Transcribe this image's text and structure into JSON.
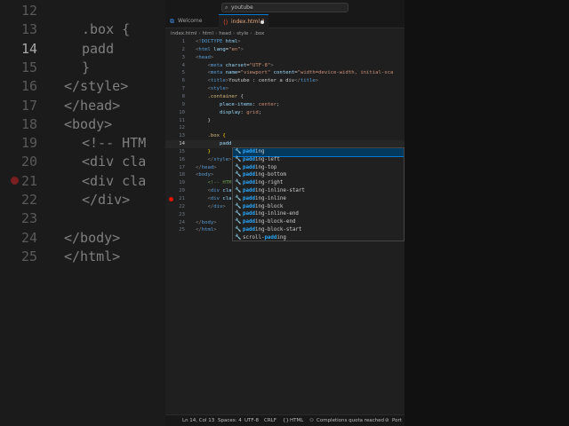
{
  "background": {
    "left_lines": [
      {
        "num": "12",
        "text": "",
        "current": false
      },
      {
        "num": "13",
        "text": ".box {",
        "current": false
      },
      {
        "num": "14",
        "text": "padd",
        "current": true
      },
      {
        "num": "15",
        "text": "}",
        "current": false
      },
      {
        "num": "16",
        "text": "</style>",
        "current": false
      },
      {
        "num": "17",
        "text": "</head>",
        "current": false
      },
      {
        "num": "18",
        "text": "<body>",
        "current": false
      },
      {
        "num": "19",
        "text": "<!-- HTM",
        "current": false
      },
      {
        "num": "20",
        "text": "<div cla",
        "current": false
      },
      {
        "num": "21",
        "text": "<div cla",
        "current": false
      },
      {
        "num": "22",
        "text": "</div>",
        "current": false
      },
      {
        "num": "23",
        "text": "",
        "current": false
      },
      {
        "num": "24",
        "text": "</body>",
        "current": false
      },
      {
        "num": "25",
        "text": "</html>",
        "current": false
      }
    ]
  },
  "titlebar": {
    "search_text": "youtube",
    "search_icon": "search-icon"
  },
  "tabs": [
    {
      "label": "Welcome",
      "icon": "vscode-icon",
      "active": false
    },
    {
      "label": "index.html 2",
      "icon": "html5-icon",
      "active": true
    }
  ],
  "breadcrumb": [
    "index.html",
    "html",
    "head",
    "style",
    ".box"
  ],
  "editor": {
    "lines": [
      {
        "num": "1",
        "html": "<span class='t-pun'>&lt;!</span><span class='t-tag'>DOCTYPE</span> <span class='t-attr'>html</span><span class='t-pun'>&gt;</span>"
      },
      {
        "num": "2",
        "html": "<span class='t-pun'>&lt;</span><span class='t-tag'>html</span> <span class='t-attr'>lang</span>=<span class='t-str'>\"en\"</span><span class='t-pun'>&gt;</span>"
      },
      {
        "num": "3",
        "html": "<span class='t-pun'>&lt;</span><span class='t-tag'>head</span><span class='t-pun'>&gt;</span>"
      },
      {
        "num": "4",
        "html": "    <span class='t-pun'>&lt;</span><span class='t-tag'>meta</span> <span class='t-attr'>charset</span>=<span class='t-str'>\"UTF-8\"</span><span class='t-pun'>&gt;</span>"
      },
      {
        "num": "5",
        "html": "    <span class='t-pun'>&lt;</span><span class='t-tag'>meta</span> <span class='t-attr'>name</span>=<span class='t-str'>\"viewport\"</span> <span class='t-attr'>content</span>=<span class='t-str'>\"width=device-width, initial-sca</span>"
      },
      {
        "num": "6",
        "html": "    <span class='t-pun'>&lt;</span><span class='t-tag'>title</span><span class='t-pun'>&gt;</span>Youtube : center a div<span class='t-pun'>&lt;/</span><span class='t-tag'>title</span><span class='t-pun'>&gt;</span>"
      },
      {
        "num": "7",
        "html": "    <span class='t-pun'>&lt;</span><span class='t-tag'>style</span><span class='t-pun'>&gt;</span>"
      },
      {
        "num": "8",
        "html": "    <span class='t-sel'>.container</span> {"
      },
      {
        "num": "9",
        "html": "        <span class='t-prop'>place-items</span>: <span class='t-val'>center</span>;"
      },
      {
        "num": "10",
        "html": "        <span class='t-prop'>display</span>: <span class='t-val'>grid</span>;"
      },
      {
        "num": "11",
        "html": "    }"
      },
      {
        "num": "12",
        "html": ""
      },
      {
        "num": "13",
        "html": "    <span class='t-sel'>.box</span> <span class='t-br'>{</span>"
      },
      {
        "num": "14",
        "html": "        <span class='t-prop'>padd</span>",
        "current": true
      },
      {
        "num": "15",
        "html": "    <span class='t-br'>}</span>"
      },
      {
        "num": "16",
        "html": "    <span class='t-pun'>&lt;/</span><span class='t-tag'>style</span><span class='t-pun'>&gt;</span>"
      },
      {
        "num": "17",
        "html": "<span class='t-pun'>&lt;/</span><span class='t-tag'>head</span><span class='t-pun'>&gt;</span>"
      },
      {
        "num": "18",
        "html": "<span class='t-pun'>&lt;</span><span class='t-tag'>body</span><span class='t-pun'>&gt;</span>"
      },
      {
        "num": "19",
        "html": "    <span class='t-cm'>&lt;!-- HTM</span>"
      },
      {
        "num": "20",
        "html": "    <span class='t-pun'>&lt;</span><span class='t-tag'>div</span> <span class='t-attr'>cla</span>"
      },
      {
        "num": "21",
        "html": "    <span class='t-pun'>&lt;</span><span class='t-tag'>div</span> <span class='t-attr'>cla</span>",
        "breakpoint": true
      },
      {
        "num": "22",
        "html": "    <span class='t-pun'>&lt;/</span><span class='t-tag'>div</span><span class='t-pun'>&gt;</span>"
      },
      {
        "num": "23",
        "html": ""
      },
      {
        "num": "24",
        "html": "<span class='t-pun'>&lt;/</span><span class='t-tag'>body</span><span class='t-pun'>&gt;</span>"
      },
      {
        "num": "25",
        "html": "<span class='t-pun'>&lt;/</span><span class='t-tag'>html</span><span class='t-pun'>&gt;</span>"
      }
    ]
  },
  "suggestions": [
    {
      "prefix": "padd",
      "rest": "ing",
      "selected": true
    },
    {
      "prefix": "padd",
      "rest": "ing-left"
    },
    {
      "prefix": "padd",
      "rest": "ing-top"
    },
    {
      "prefix": "padd",
      "rest": "ing-bottom"
    },
    {
      "prefix": "padd",
      "rest": "ing-right"
    },
    {
      "prefix": "padd",
      "rest": "ing-inline-start"
    },
    {
      "prefix": "padd",
      "rest": "ing-inline"
    },
    {
      "prefix": "padd",
      "rest": "ing-block"
    },
    {
      "prefix": "padd",
      "rest": "ing-inline-end"
    },
    {
      "prefix": "padd",
      "rest": "ing-block-end"
    },
    {
      "prefix": "padd",
      "rest": "ing-block-start"
    },
    {
      "before": "scroll-",
      "prefix": "padd",
      "rest": "ing"
    }
  ],
  "suggestion_icon": "wrench-icon",
  "statusbar": {
    "position": "Ln 14, Col 13",
    "spaces": "Spaces: 4",
    "encoding": "UTF-8",
    "eol": "CRLF",
    "language": "HTML",
    "copilot": "Completions quota reached",
    "port": "Port"
  }
}
